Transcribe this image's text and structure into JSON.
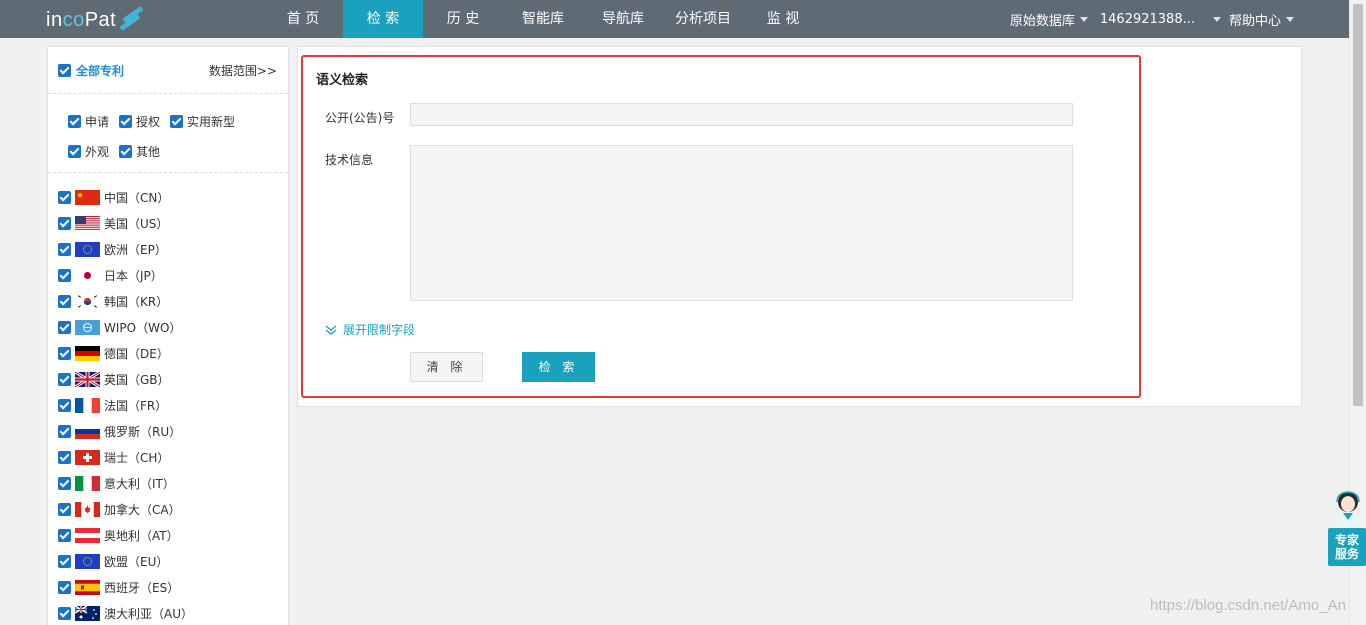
{
  "header": {
    "logo_in": "in",
    "logo_co": "co",
    "logo_pat": "Pat",
    "nav": [
      {
        "label": "首 页",
        "active": false
      },
      {
        "label": "检 索",
        "active": true
      },
      {
        "label": "历 史",
        "active": false
      },
      {
        "label": "智能库",
        "active": false
      },
      {
        "label": "导航库",
        "active": false
      },
      {
        "label": "分析项目",
        "active": false
      },
      {
        "label": "监 视",
        "active": false
      }
    ],
    "database_label": "原始数据库",
    "user_label": "1462921388...",
    "help_label": "帮助中心"
  },
  "sidebar": {
    "all_label": "全部专利",
    "range_link": "数据范围>>",
    "types_row1": [
      "申请",
      "授权",
      "实用新型"
    ],
    "types_row2": [
      "外观",
      "其他"
    ],
    "countries": [
      {
        "label": "中国（CN）",
        "flag": "cn"
      },
      {
        "label": "美国（US）",
        "flag": "us"
      },
      {
        "label": "欧洲（EP）",
        "flag": "eu"
      },
      {
        "label": "日本（JP）",
        "flag": "jp"
      },
      {
        "label": "韩国（KR）",
        "flag": "kr"
      },
      {
        "label": "WIPO（WO）",
        "flag": "wo"
      },
      {
        "label": "德国（DE）",
        "flag": "de"
      },
      {
        "label": "英国（GB）",
        "flag": "gb"
      },
      {
        "label": "法国（FR）",
        "flag": "fr"
      },
      {
        "label": "俄罗斯（RU）",
        "flag": "ru"
      },
      {
        "label": "瑞士（CH）",
        "flag": "ch"
      },
      {
        "label": "意大利（IT）",
        "flag": "it"
      },
      {
        "label": "加拿大（CA）",
        "flag": "ca"
      },
      {
        "label": "奥地利（AT）",
        "flag": "at"
      },
      {
        "label": "欧盟（EU）",
        "flag": "eu"
      },
      {
        "label": "西班牙（ES）",
        "flag": "es"
      },
      {
        "label": "澳大利亚（AU）",
        "flag": "au"
      }
    ]
  },
  "form": {
    "title": "语义检索",
    "pub_number_label": "公开(公告)号",
    "pub_number_value": "",
    "tech_info_label": "技术信息",
    "tech_info_value": "",
    "expand_label": "展开限制字段",
    "clear_label": "清 除",
    "search_label": "检 索"
  },
  "expert_widget": {
    "line1": "专家",
    "line2": "服务"
  },
  "watermark": "https://blog.csdn.net/Amo_An",
  "colors": {
    "topbar": "#5e6a74",
    "accent": "#1aa1bd",
    "highlight_border": "#e53935",
    "checkbox": "#1a73c7"
  }
}
